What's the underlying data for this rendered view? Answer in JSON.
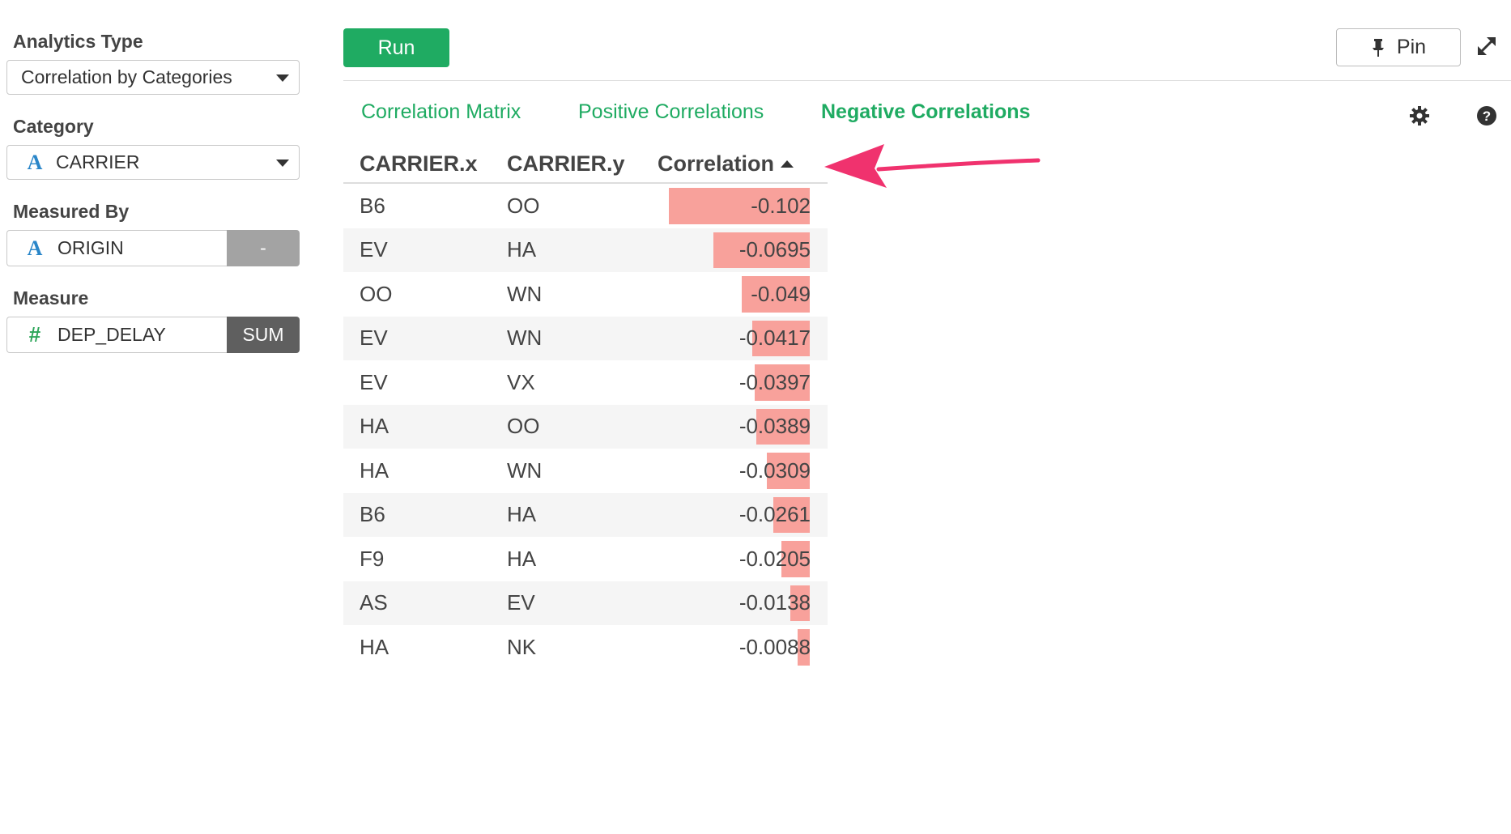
{
  "sidebar": {
    "analytics_type": {
      "label": "Analytics Type",
      "value": "Correlation by Categories"
    },
    "category": {
      "label": "Category",
      "value": "CARRIER",
      "type_icon": "A"
    },
    "measured_by": {
      "label": "Measured By",
      "value": "ORIGIN",
      "type_icon": "A",
      "side": "-"
    },
    "measure": {
      "label": "Measure",
      "value": "DEP_DELAY",
      "type_icon": "#",
      "side": "SUM"
    }
  },
  "toolbar": {
    "run_label": "Run",
    "pin_label": "Pin"
  },
  "tabs": [
    {
      "label": "Correlation Matrix",
      "active": false
    },
    {
      "label": "Positive Correlations",
      "active": false
    },
    {
      "label": "Negative Correlations",
      "active": true
    }
  ],
  "table": {
    "columns": [
      "CARRIER.x",
      "CARRIER.y",
      "Correlation"
    ],
    "sort": "Correlation ascending",
    "rows": [
      {
        "x": "B6",
        "y": "OO",
        "corr": "-0.102",
        "magnitude": 0.102
      },
      {
        "x": "EV",
        "y": "HA",
        "corr": "-0.0695",
        "magnitude": 0.0695
      },
      {
        "x": "OO",
        "y": "WN",
        "corr": "-0.049",
        "magnitude": 0.049
      },
      {
        "x": "EV",
        "y": "WN",
        "corr": "-0.0417",
        "magnitude": 0.0417
      },
      {
        "x": "EV",
        "y": "VX",
        "corr": "-0.0397",
        "magnitude": 0.0397
      },
      {
        "x": "HA",
        "y": "OO",
        "corr": "-0.0389",
        "magnitude": 0.0389
      },
      {
        "x": "HA",
        "y": "WN",
        "corr": "-0.0309",
        "magnitude": 0.0309
      },
      {
        "x": "B6",
        "y": "HA",
        "corr": "-0.0261",
        "magnitude": 0.0261
      },
      {
        "x": "F9",
        "y": "HA",
        "corr": "-0.0205",
        "magnitude": 0.0205
      },
      {
        "x": "AS",
        "y": "EV",
        "corr": "-0.0138",
        "magnitude": 0.0138
      },
      {
        "x": "HA",
        "y": "NK",
        "corr": "-0.0088",
        "magnitude": 0.0088
      }
    ]
  },
  "colors": {
    "accent": "#1fab62",
    "bar": "#f8a19b",
    "annotation_arrow": "#f0326e"
  }
}
